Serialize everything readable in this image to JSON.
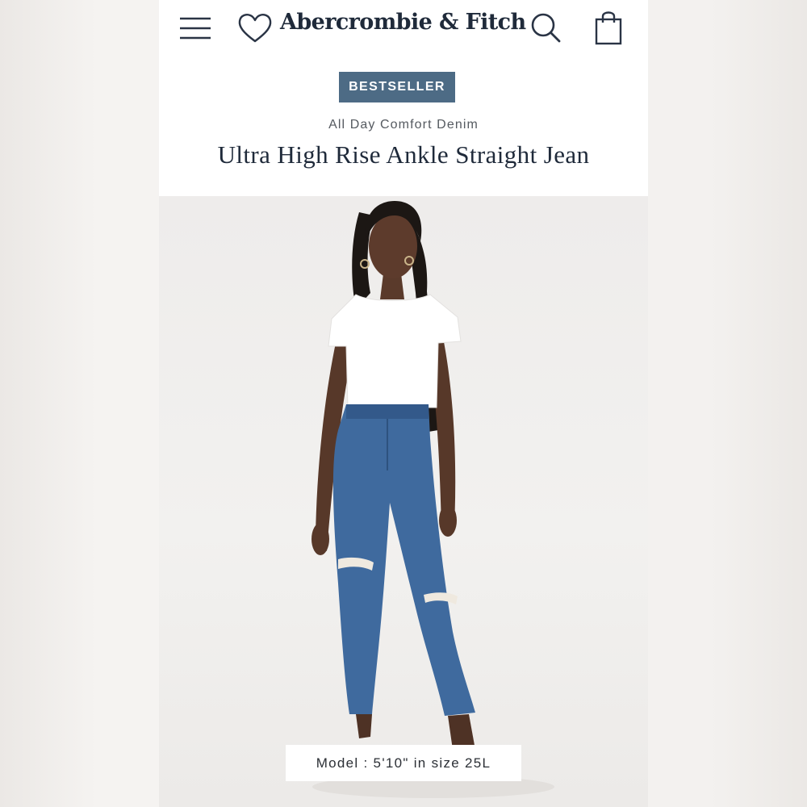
{
  "header": {
    "brand": "Abercrombie & Fitch",
    "icons": [
      "menu-icon",
      "heart-icon",
      "search-icon",
      "shopping-bag-icon"
    ]
  },
  "product": {
    "badge": "BESTSELLER",
    "collection": "All Day Comfort Denim",
    "name": "Ultra High Rise Ankle Straight Jean"
  },
  "image": {
    "model_caption": "Model : 5'10\" in size 25L"
  },
  "colors": {
    "badge_background": "#4d6b85",
    "brand_text": "#1f2a3a",
    "denim": "#3f6a9e"
  }
}
